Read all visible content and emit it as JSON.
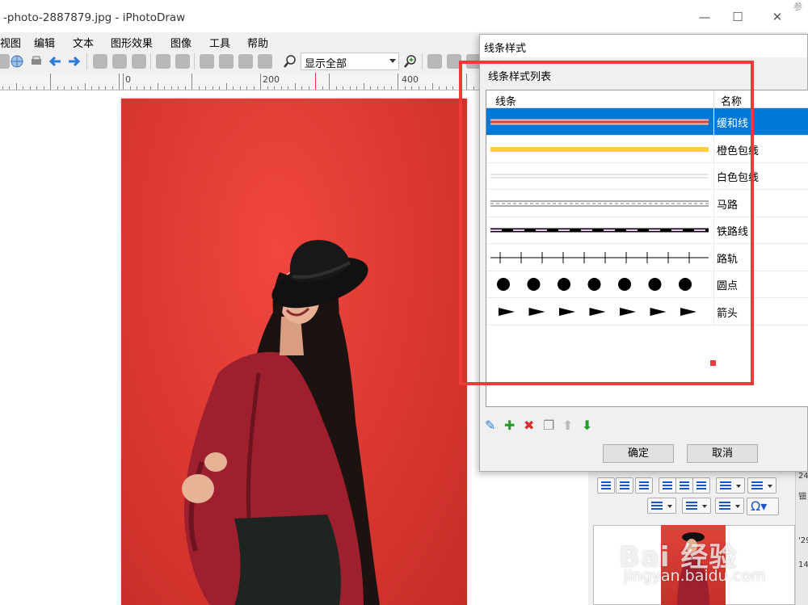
{
  "window": {
    "title": "-photo-2887879.jpg - iPhotoDraw",
    "minimize": "—",
    "maximize": "☐",
    "close": "✕",
    "corner_text": "参"
  },
  "menu": [
    "视图",
    "编辑",
    "文本",
    "图形效果",
    "图像",
    "工具",
    "帮助"
  ],
  "toolbar": {
    "zoom_value": "显示全部"
  },
  "ruler": {
    "labels": [
      "0",
      "200",
      "400"
    ]
  },
  "dialog": {
    "title": "线条样式",
    "group_label": "线条样式列表",
    "columns": {
      "line": "线条",
      "name": "名称"
    },
    "rows": [
      {
        "name": "缓和线",
        "style": "soft",
        "color": "#c0504d",
        "selected": true
      },
      {
        "name": "橙色包线",
        "style": "orange",
        "color": "#ffc000",
        "selected": false
      },
      {
        "name": "白色包线",
        "style": "white",
        "color": "#d9d9d9",
        "selected": false
      },
      {
        "name": "马路",
        "style": "road",
        "color": "#808080",
        "selected": false
      },
      {
        "name": "铁路线",
        "style": "railway",
        "color": "#000000",
        "selected": false
      },
      {
        "name": "路轨",
        "style": "track",
        "color": "#000000",
        "selected": false
      },
      {
        "name": "圆点",
        "style": "dots",
        "color": "#000000",
        "selected": false
      },
      {
        "name": "箭头",
        "style": "arrows",
        "color": "#000000",
        "selected": false
      }
    ],
    "ok": "确定",
    "cancel": "取消"
  },
  "watermark": {
    "main": "Bai 经验",
    "sub": "jingyan.baidu.com"
  },
  "edge_strip": [
    "24",
    "钿",
    "'29",
    "14"
  ],
  "accent_color": "#0078d7",
  "highlight_color": "#f03a3a"
}
